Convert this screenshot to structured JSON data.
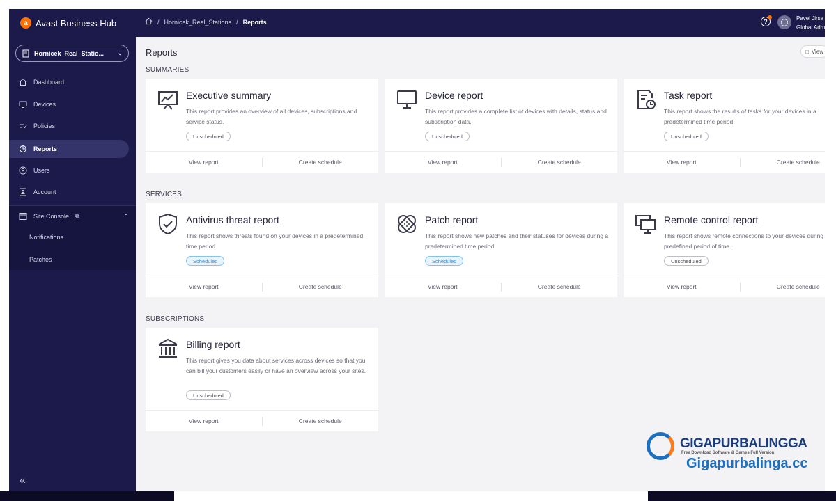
{
  "app": {
    "brand": "Avast Business Hub"
  },
  "site_selector": {
    "value": "Hornicek_Real_Statio..."
  },
  "sidebar": {
    "items": [
      {
        "label": "Dashboard",
        "icon": "home-icon"
      },
      {
        "label": "Devices",
        "icon": "monitor-icon"
      },
      {
        "label": "Policies",
        "icon": "policies-icon"
      },
      {
        "label": "Reports",
        "icon": "pie-chart-icon",
        "active": true
      },
      {
        "label": "Users",
        "icon": "user-circle-icon"
      },
      {
        "label": "Account",
        "icon": "account-icon"
      }
    ],
    "console": {
      "label": "Site Console",
      "sub_items": [
        "Notifications",
        "Patches"
      ]
    }
  },
  "breadcrumb": [
    "Hornicek_Real_Stations",
    "Reports"
  ],
  "user": {
    "name": "Pavel Jirsa",
    "role": "Global Adm"
  },
  "page": {
    "title": "Reports",
    "view_button": "View"
  },
  "sections": [
    {
      "title": "SUMMARIES",
      "cards": [
        {
          "title": "Executive summary",
          "desc": "This report provides an overview of all devices, subscriptions and service status.",
          "status": "Unscheduled",
          "icon": "presentation-chart-icon"
        },
        {
          "title": "Device report",
          "desc": "This report provides a complete list of devices with details, status and subscription data.",
          "status": "Unscheduled",
          "icon": "monitor-icon"
        },
        {
          "title": "Task report",
          "desc": "This report shows the results of tasks for your devices in a predetermined time period.",
          "status": "Unscheduled",
          "icon": "task-clock-icon"
        }
      ]
    },
    {
      "title": "SERVICES",
      "cards": [
        {
          "title": "Antivirus threat report",
          "desc": "This report shows threats found on your devices in a predetermined time period.",
          "status": "Scheduled",
          "icon": "shield-check-icon"
        },
        {
          "title": "Patch report",
          "desc": "This report shows new patches and their statuses for devices during a predetermined time period.",
          "status": "Scheduled",
          "icon": "bandage-icon"
        },
        {
          "title": "Remote control report",
          "desc": "This report shows remote connections to your devices during a predefined period of time.",
          "status": "Unscheduled",
          "icon": "remote-screens-icon"
        }
      ]
    },
    {
      "title": "SUBSCRIPTIONS",
      "cards": [
        {
          "title": "Billing report",
          "desc": "This report gives you data about services across devices so that you can bill your customers easily or have an overview across your sites.",
          "status": "Unscheduled",
          "icon": "bank-icon"
        }
      ]
    }
  ],
  "card_actions": {
    "view": "View report",
    "schedule": "Create schedule"
  },
  "watermark": {
    "name": "GIGAPURBALINGGA",
    "tagline": "Free Download Software & Games Full Version",
    "url": "Gigapurbalinga.cc"
  }
}
